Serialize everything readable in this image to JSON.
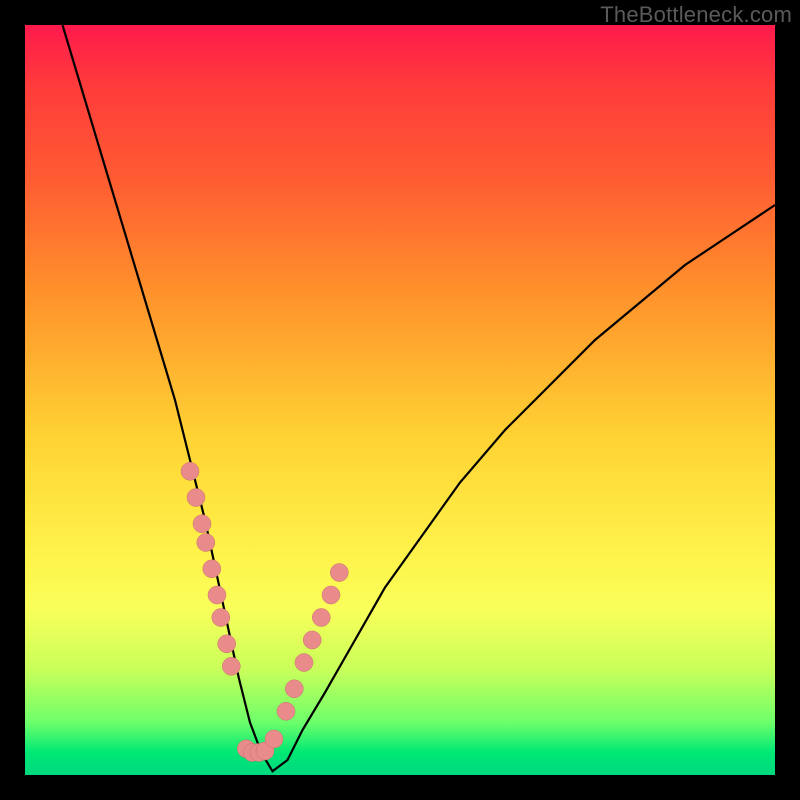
{
  "watermark": "TheBottleneck.com",
  "colors": {
    "frame_bg": "#000000",
    "dot_fill": "#e98b8a",
    "dot_stroke": "#c77170",
    "curve_stroke": "#000000"
  },
  "chart_data": {
    "type": "line",
    "title": "",
    "xlabel": "",
    "ylabel": "",
    "xlim": [
      0,
      100
    ],
    "ylim": [
      0,
      100
    ],
    "notes": "V-shaped bottleneck curve; y roughly represents mismatch percentage (0 at bottom). Background hue runs red (high mismatch) → green (low mismatch). Pink dots mark sample hardware points near the minimum.",
    "series": [
      {
        "name": "bottleneck-curve",
        "x": [
          5,
          8,
          11,
          14,
          17,
          20,
          22,
          24,
          25.5,
          27,
          28.5,
          30,
          31.5,
          33,
          35,
          37,
          40,
          44,
          48,
          53,
          58,
          64,
          70,
          76,
          82,
          88,
          94,
          100
        ],
        "y": [
          100,
          90,
          80,
          70,
          60,
          50,
          42,
          34,
          27,
          20,
          13,
          7,
          3,
          0.5,
          2,
          6,
          11,
          18,
          25,
          32,
          39,
          46,
          52,
          58,
          63,
          68,
          72,
          76
        ]
      }
    ],
    "points": {
      "name": "sample-dots",
      "x": [
        22.0,
        22.8,
        23.6,
        24.1,
        24.9,
        25.6,
        26.1,
        26.9,
        27.5,
        29.5,
        30.3,
        31.2,
        32.0,
        33.2,
        34.8,
        35.9,
        37.2,
        38.3,
        39.5,
        40.8,
        41.9
      ],
      "y": [
        40.5,
        37.0,
        33.5,
        31.0,
        27.5,
        24.0,
        21.0,
        17.5,
        14.5,
        3.5,
        3.0,
        3.0,
        3.2,
        4.8,
        8.5,
        11.5,
        15.0,
        18.0,
        21.0,
        24.0,
        27.0
      ]
    }
  }
}
